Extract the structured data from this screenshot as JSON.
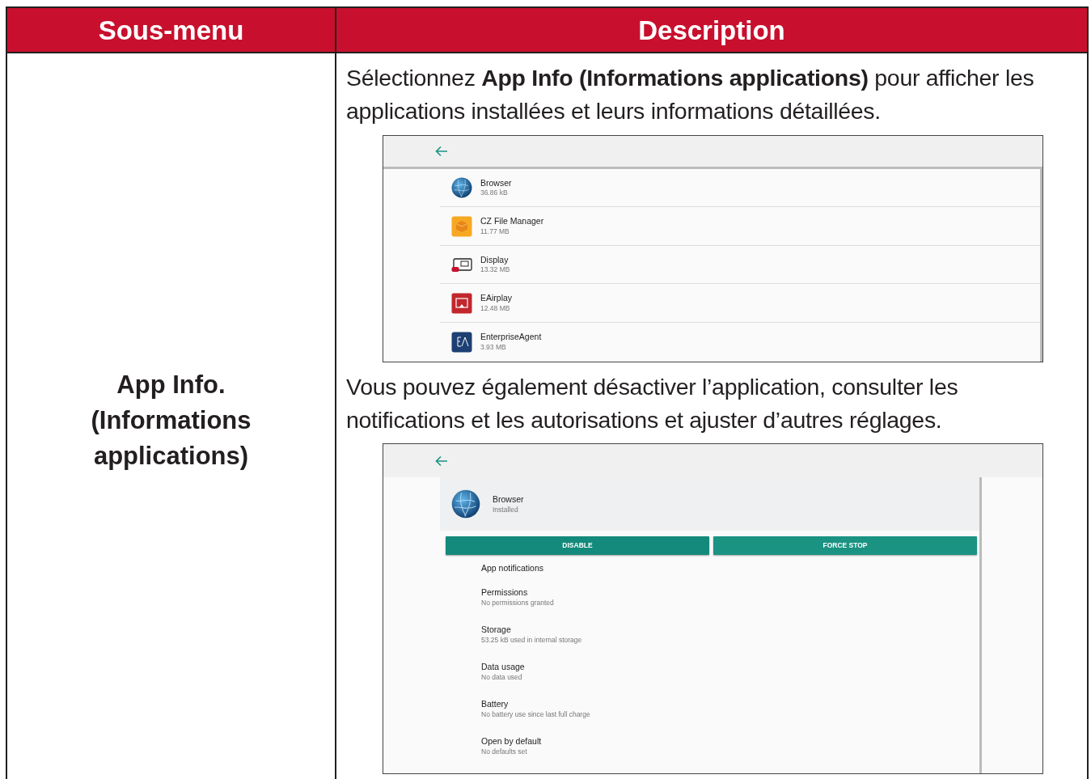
{
  "table": {
    "columns": [
      "Sous-menu",
      "Description"
    ],
    "row": {
      "submenu": "App Info. (Informations applications)",
      "intro": "Sélectionnez **App Info (Informations applications)** pour afficher les applications installées et leurs informations détaillées.",
      "app_list_screen": {
        "apps": [
          {
            "name": "Browser",
            "size": "36.86 kB",
            "kind": "globe"
          },
          {
            "name": "CZ File Manager",
            "size": "11.77 MB",
            "kind": "folder"
          },
          {
            "name": "Display",
            "size": "13.32 MB",
            "kind": "display"
          },
          {
            "name": "EAirplay",
            "size": "12.48 MB",
            "kind": "airplay"
          },
          {
            "name": "EnterpriseAgent",
            "size": "3.93 MB",
            "kind": "agent"
          }
        ]
      },
      "followup": "Vous pouvez également désactiver l’application, consulter les notifications et les autorisations et ajuster d’autres réglages.",
      "app_detail_screen": {
        "app": {
          "name": "Browser",
          "status": "Installed",
          "kind": "globe"
        },
        "buttons": [
          "DISABLE",
          "FORCE STOP"
        ],
        "settings": [
          {
            "title": "App notifications"
          },
          {
            "title": "Permissions",
            "summary": "No permissions granted"
          },
          {
            "title": "Storage",
            "summary": "53.25 kB used in internal storage"
          },
          {
            "title": "Data usage",
            "summary": "No data used"
          },
          {
            "title": "Battery",
            "summary": "No battery use since last full charge"
          },
          {
            "title": "Open by default",
            "summary": "No defaults set"
          }
        ]
      }
    }
  }
}
